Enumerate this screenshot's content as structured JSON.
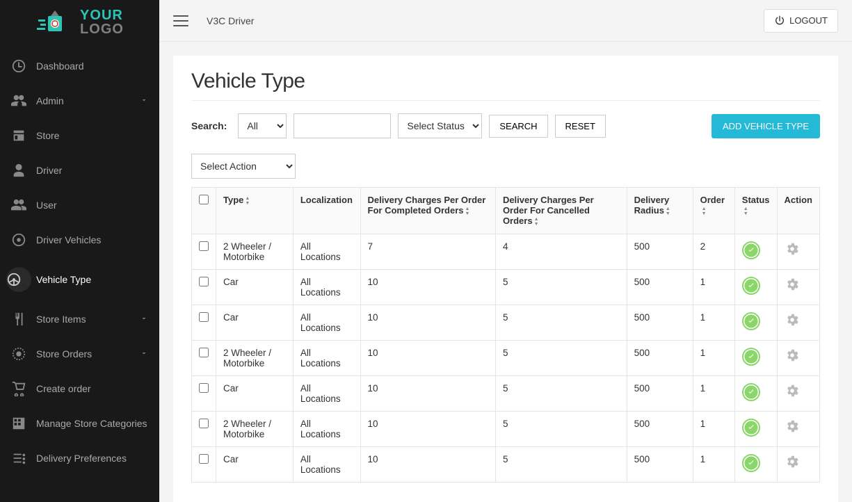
{
  "logo": {
    "your": "YOUR",
    "logo": "LOGO"
  },
  "sidebar": {
    "items": [
      {
        "label": "Dashboard"
      },
      {
        "label": "Admin"
      },
      {
        "label": "Store"
      },
      {
        "label": "Driver"
      },
      {
        "label": "User"
      },
      {
        "label": "Driver Vehicles"
      },
      {
        "label": "Vehicle Type"
      },
      {
        "label": "Store Items"
      },
      {
        "label": "Store Orders"
      },
      {
        "label": "Create order"
      },
      {
        "label": "Manage Store Categories"
      },
      {
        "label": "Delivery Preferences"
      }
    ]
  },
  "topbar": {
    "breadcrumb": "V3C  Driver",
    "logout": "LOGOUT"
  },
  "page": {
    "title": "Vehicle Type",
    "search_label": "Search:",
    "filter_all": "All",
    "filter_status": "Select Status",
    "btn_search": "SEARCH",
    "btn_reset": "RESET",
    "btn_add": "ADD VEHICLE TYPE",
    "select_action": "Select Action"
  },
  "table": {
    "headers": {
      "type": "Type",
      "localization": "Localization",
      "completed": "Delivery Charges Per Order For Completed Orders",
      "cancelled": "Delivery Charges Per Order For Cancelled Orders",
      "radius": "Delivery Radius",
      "order": "Order",
      "status": "Status",
      "action": "Action"
    },
    "rows": [
      {
        "type": "2 Wheeler / Motorbike",
        "localization": "All Locations",
        "completed": "7",
        "cancelled": "4",
        "radius": "500",
        "order": "2"
      },
      {
        "type": "Car",
        "localization": "All Locations",
        "completed": "10",
        "cancelled": "5",
        "radius": "500",
        "order": "1"
      },
      {
        "type": "Car",
        "localization": "All Locations",
        "completed": "10",
        "cancelled": "5",
        "radius": "500",
        "order": "1"
      },
      {
        "type": "2 Wheeler / Motorbike",
        "localization": "All Locations",
        "completed": "10",
        "cancelled": "5",
        "radius": "500",
        "order": "1"
      },
      {
        "type": "Car",
        "localization": "All Locations",
        "completed": "10",
        "cancelled": "5",
        "radius": "500",
        "order": "1"
      },
      {
        "type": "2 Wheeler / Motorbike",
        "localization": "All Locations",
        "completed": "10",
        "cancelled": "5",
        "radius": "500",
        "order": "1"
      },
      {
        "type": "Car",
        "localization": "All Locations",
        "completed": "10",
        "cancelled": "5",
        "radius": "500",
        "order": "1"
      }
    ]
  }
}
